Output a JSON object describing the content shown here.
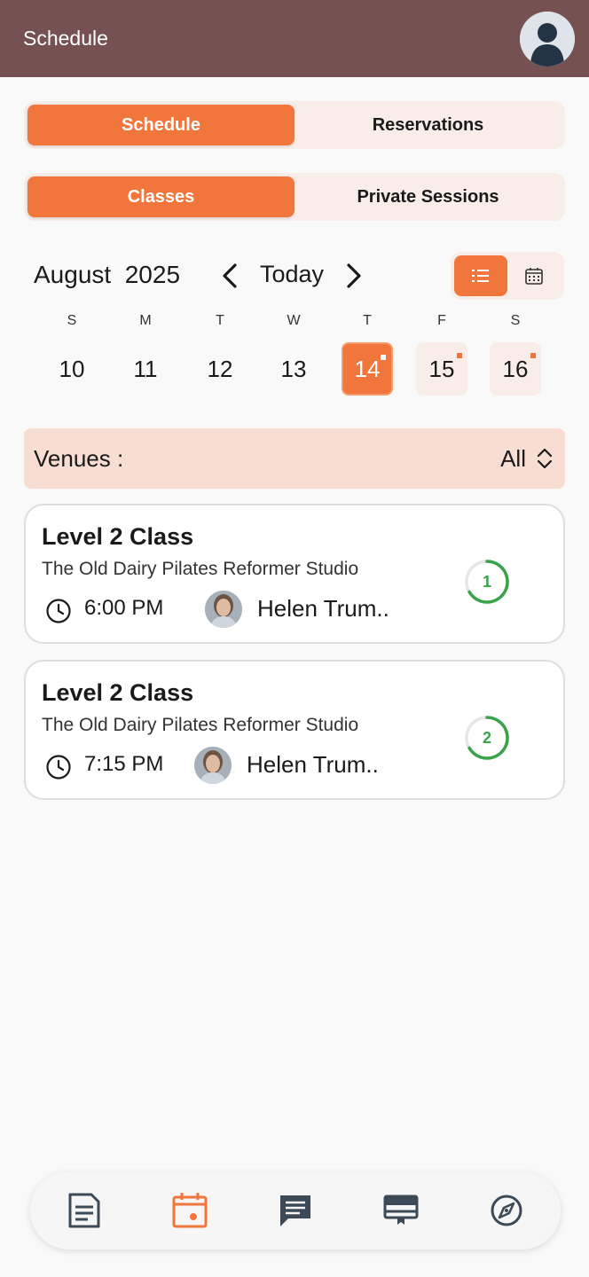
{
  "header": {
    "title": "Schedule"
  },
  "tabs_primary": [
    {
      "label": "Schedule",
      "active": true
    },
    {
      "label": "Reservations",
      "active": false
    }
  ],
  "tabs_secondary": [
    {
      "label": "Classes",
      "active": true
    },
    {
      "label": "Private Sessions",
      "active": false
    }
  ],
  "calendar": {
    "month_label": "August  2025",
    "today_label": "Today",
    "view_modes": [
      {
        "icon": "list-icon",
        "active": true
      },
      {
        "icon": "calendar-grid-icon",
        "active": false
      }
    ],
    "days": [
      {
        "letter": "S",
        "number": "10",
        "has_classes": false,
        "selected": false
      },
      {
        "letter": "M",
        "number": "11",
        "has_classes": false,
        "selected": false
      },
      {
        "letter": "T",
        "number": "12",
        "has_classes": false,
        "selected": false
      },
      {
        "letter": "W",
        "number": "13",
        "has_classes": false,
        "selected": false
      },
      {
        "letter": "T",
        "number": "14",
        "has_classes": true,
        "selected": true
      },
      {
        "letter": "F",
        "number": "15",
        "has_classes": true,
        "selected": false
      },
      {
        "letter": "S",
        "number": "16",
        "has_classes": true,
        "selected": false
      }
    ]
  },
  "venues": {
    "label": "Venues :",
    "selected": "All"
  },
  "classes": [
    {
      "title": "Level 2 Class",
      "venue": "The Old Dairy Pilates Reformer Studio",
      "time": "6:00 PM",
      "instructor": "Helen Trum..",
      "booked": "1"
    },
    {
      "title": "Level 2 Class",
      "venue": "The Old Dairy Pilates Reformer Studio",
      "time": "7:15 PM",
      "instructor": "Helen Trum..",
      "booked": "2"
    }
  ],
  "bottom_nav": [
    {
      "icon": "document-icon",
      "active": false
    },
    {
      "icon": "calendar-icon",
      "active": true
    },
    {
      "icon": "chat-icon",
      "active": false
    },
    {
      "icon": "board-icon",
      "active": false
    },
    {
      "icon": "compass-icon",
      "active": false
    }
  ],
  "colors": {
    "header": "#765151",
    "accent": "#f0763c",
    "accent_soft": "#f8ede8",
    "venues_bg": "#f8ded2",
    "capacity": "#3aa34a",
    "nav_icon": "#3c4a58"
  }
}
